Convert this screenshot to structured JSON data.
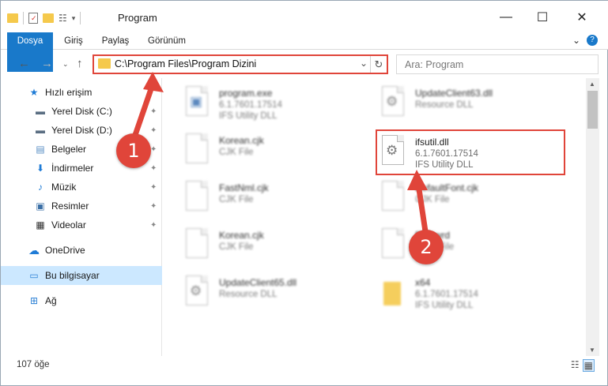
{
  "window": {
    "title": "Program",
    "minimize": "—",
    "maximize": "☐",
    "close": "✕"
  },
  "ribbon": {
    "tabs": [
      "Dosya",
      "Giriş",
      "Paylaş",
      "Görünüm"
    ],
    "expand_icon": "⌄",
    "help_icon": "?"
  },
  "address": {
    "path": "C:\\Program Files\\Program Dizini",
    "dropdown": "⌄",
    "refresh": "↻"
  },
  "search": {
    "placeholder": "Ara: Program"
  },
  "sidebar": {
    "items": [
      {
        "label": "Hızlı erişim",
        "icon": "star-icon",
        "glyph": "★",
        "color": "#1e7bd6"
      },
      {
        "label": "Yerel Disk (C:)",
        "icon": "drive-c-icon",
        "glyph": "▬",
        "color": "#5a6e82"
      },
      {
        "label": "Yerel Disk (D:)",
        "icon": "drive-d-icon",
        "glyph": "▬",
        "color": "#5a6e82"
      },
      {
        "label": "Belgeler",
        "icon": "documents-icon",
        "glyph": "▤",
        "color": "#5a8fc4"
      },
      {
        "label": "İndirmeler",
        "icon": "downloads-icon",
        "glyph": "⬇",
        "color": "#1e7bd6"
      },
      {
        "label": "Müzik",
        "icon": "music-icon",
        "glyph": "♪",
        "color": "#1e7bd6"
      },
      {
        "label": "Resimler",
        "icon": "pictures-icon",
        "glyph": "▣",
        "color": "#3b6fa6"
      },
      {
        "label": "Videolar",
        "icon": "videos-icon",
        "glyph": "▦",
        "color": "#333333"
      },
      {
        "label": "OneDrive",
        "icon": "onedrive-icon",
        "glyph": "☁",
        "color": "#1e7bd6"
      },
      {
        "label": "Bu bilgisayar",
        "icon": "this-pc-icon",
        "glyph": "▭",
        "color": "#2a7fd4"
      },
      {
        "label": "Ağ",
        "icon": "network-icon",
        "glyph": "⊞",
        "color": "#2a7fd4"
      }
    ],
    "pin_glyph": "📌"
  },
  "files": [
    {
      "name": "program.exe",
      "info1": "6.1.7601.17514",
      "info2": "IFS Utility DLL"
    },
    {
      "name": "UpdateClient63.dll",
      "info1": "Resource DLL",
      "info2": ""
    },
    {
      "name": "Korean.cjk",
      "info1": "CJK File",
      "info2": ""
    },
    {
      "name": "ifsutil.dll",
      "info1": "6.1.7601.17514",
      "info2": "IFS Utility DLL"
    },
    {
      "name": "FastNml.cjk",
      "info1": "CJK File",
      "info2": ""
    },
    {
      "name": "DefaultFont.cjk",
      "info1": "CJK File",
      "info2": ""
    },
    {
      "name": "Korean.cjk",
      "info1": "CJK File",
      "info2": ""
    },
    {
      "name": "Dbc.wrd",
      "info1": "WRD File",
      "info2": ""
    },
    {
      "name": "UpdateClient65.dll",
      "info1": "Resource DLL",
      "info2": ""
    },
    {
      "name": "x64",
      "info1": "6.1.7601.17514",
      "info2": "IFS Utility DLL"
    }
  ],
  "status": {
    "item_count": "107 öğe",
    "details_view": "☷",
    "tiles_view": "▦"
  },
  "markers": {
    "one": "1",
    "two": "2"
  },
  "colors": {
    "accent": "#1979ca",
    "annotation": "#e0453a",
    "selected": "#cce8ff"
  }
}
